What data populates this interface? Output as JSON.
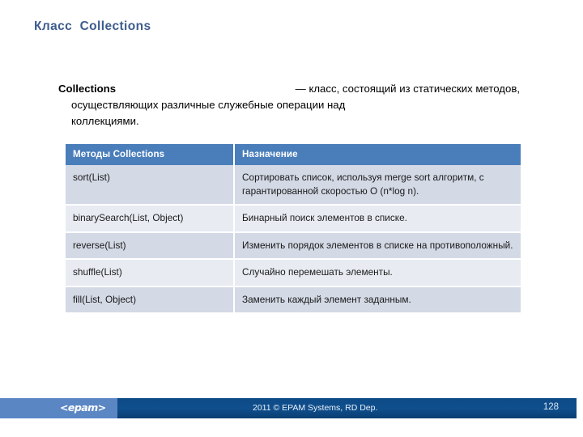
{
  "slide": {
    "title": "Класс  Collections",
    "title_color": "#3d5c8e"
  },
  "body": {
    "lead": "Collections",
    "line1_rest": "— класс, состоящий из статических методов,",
    "line2": "осуществляющих различные служебные операции над",
    "line3": "коллекциями.",
    "full_text": "Collections — класс, состоящий из статических методов, осуществляющих различные служебные операции над коллекциями."
  },
  "table": {
    "header_bg": "#4a7ebb",
    "row_dark_bg": "#d3d9e5",
    "row_light_bg": "#e8ebf2",
    "columns": [
      "Методы Collections",
      "Назначение"
    ],
    "rows": [
      {
        "method": "sort(List)",
        "description": "Сортировать список, используя merge sort алгоритм, с гарантированной скоростью O (n*log n)."
      },
      {
        "method": "binarySearch(List, Object)",
        "description": "Бинарный поиск элементов в списке."
      },
      {
        "method": "reverse(List)",
        "description": "Изменить порядок элементов в списке на противоположный."
      },
      {
        "method": "shuffle(List)",
        "description": "Случайно перемешать элементы."
      },
      {
        "method": "fill(List, Object)",
        "description": "Заменить каждый элемент заданным."
      }
    ]
  },
  "footer": {
    "logo": "<epam>",
    "copyright": "2011 © EPAM Systems, RD Dep.",
    "page_number": "128",
    "left_bg": "#5b86c4",
    "right_bg": "#104a83"
  }
}
